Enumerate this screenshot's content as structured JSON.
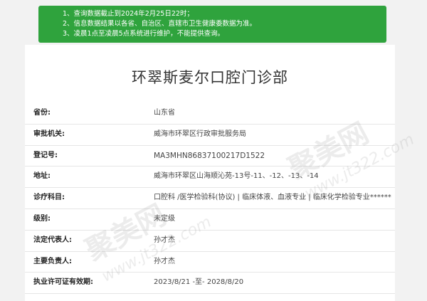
{
  "notice": {
    "lines": [
      "1、查询数据截止到2024年2月25日22时；",
      "2、信息数据结果以各省、自治区、直辖市卫生健康委数据为准。",
      "3、凌晨1点至凌晨5点系统进行维护，不能提供查询。"
    ]
  },
  "page_title": "环翠斯麦尔口腔门诊部",
  "rows": [
    {
      "label": "省份:",
      "value": "山东省"
    },
    {
      "label": "审批机关:",
      "value": "威海市环翠区行政审批服务局"
    },
    {
      "label": "登记号:",
      "value": "MA3MHN86837100217D1522"
    },
    {
      "label": "地址:",
      "value": "威海市环翠区山海顺沁苑-13号-11、-12、-13、-14"
    },
    {
      "label": "诊疗科目:",
      "value": "口腔科 /医学检验科(协议) | 临床体液、血液专业 | 临床化学检验专业******"
    },
    {
      "label": "级别:",
      "value": "未定级"
    },
    {
      "label": "法定代表人:",
      "value": "孙才杰"
    },
    {
      "label": "主要负责人:",
      "value": "孙才杰"
    },
    {
      "label": "执业许可证有效期:",
      "value": "2023/8/21 -至- 2028/8/20"
    }
  ],
  "watermark": {
    "brand": "聚美网",
    "url": "www.jt322.com"
  }
}
